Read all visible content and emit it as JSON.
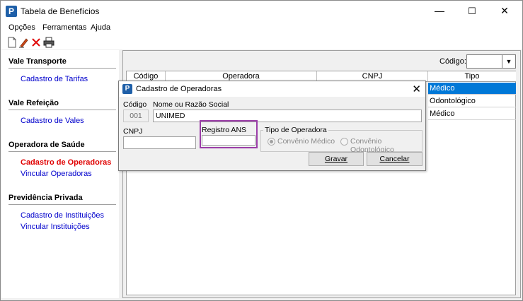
{
  "window": {
    "title": "Tabela de Benefícios",
    "minimize": "—",
    "maximize": "☐",
    "close": "✕"
  },
  "menu": [
    "Opções",
    "Ferramentas",
    "Ajuda"
  ],
  "toolbar": [
    "new-document-icon",
    "edit-icon",
    "delete-icon",
    "print-icon"
  ],
  "sidebar": {
    "sections": [
      {
        "title": "Vale Transporte",
        "links": [
          "Cadastro de Tarifas"
        ]
      },
      {
        "title": "Vale Refeição",
        "links": [
          "Cadastro de Vales"
        ]
      },
      {
        "title": "Operadora de Saúde",
        "links": [
          "Cadastro de Operadoras",
          "Vincular Operadoras"
        ]
      },
      {
        "title": "Previdência Privada",
        "links": [
          "Cadastro de Instituições",
          "Vincular Instituições"
        ]
      }
    ]
  },
  "main": {
    "code_label": "Código:",
    "code_value": "",
    "grid": {
      "columns": [
        "Código",
        "Operadora",
        "CNPJ",
        "Tipo"
      ],
      "tipo_values": [
        "Médico",
        "Odontológico",
        "Médico"
      ]
    }
  },
  "dialog": {
    "title": "Cadastro de Operadoras",
    "codigo_label": "Código",
    "codigo_value": "001",
    "nome_label": "Nome ou Razão Social",
    "nome_value": "UNIMED",
    "cnpj_label": "CNPJ",
    "cnpj_value": "",
    "registro_label": "Registro ANS",
    "registro_value": "",
    "tipo_group_label": "Tipo de Operadora",
    "radio_medico": "Convênio Médico",
    "radio_odonto": "Convênio Odontológico",
    "gravar": "Gravar",
    "cancelar": "Cancelar"
  },
  "colors": {
    "accent": "#0078d7",
    "link": "#0000cc",
    "active_link": "#e00000",
    "highlight_border": "#9b3da8"
  }
}
